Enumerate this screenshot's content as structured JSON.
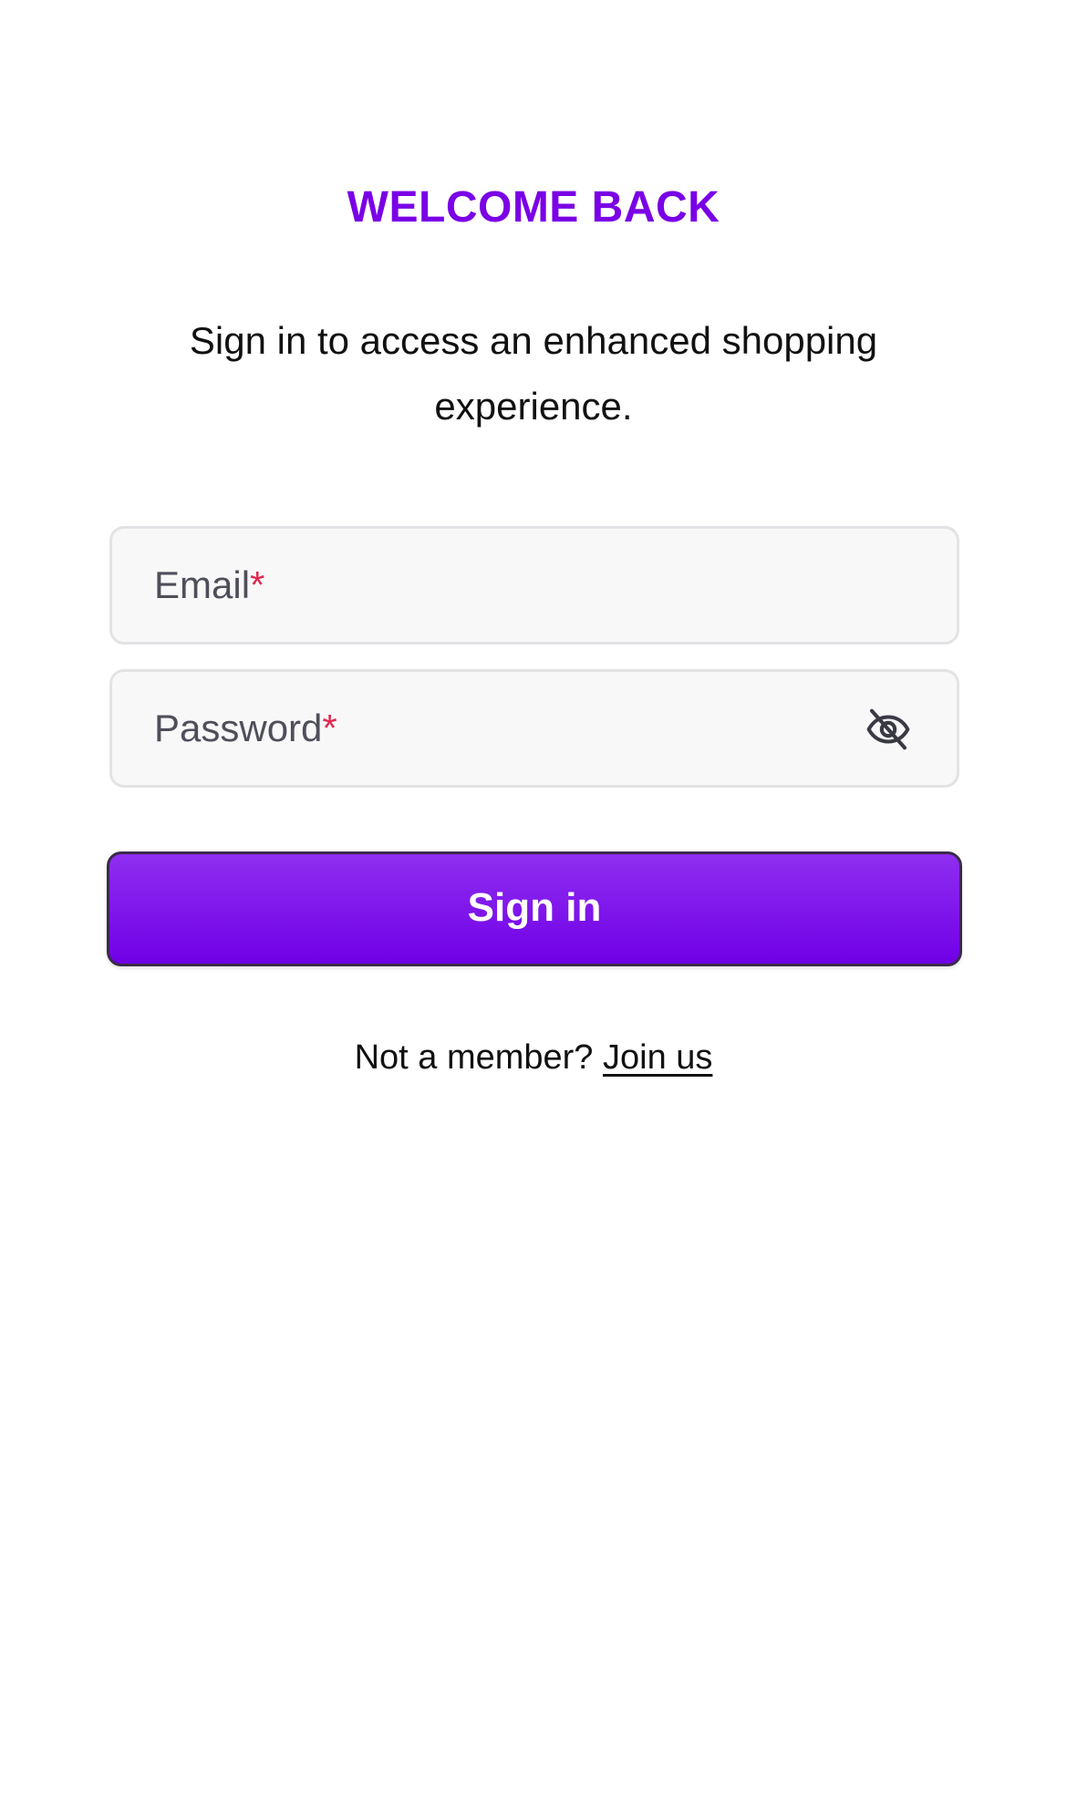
{
  "header": {
    "title": "WELCOME BACK",
    "subtitle": "Sign in to access an enhanced shopping experience."
  },
  "form": {
    "email": {
      "label": "Email",
      "required_marker": "*",
      "value": ""
    },
    "password": {
      "label": "Password",
      "required_marker": "*",
      "value": "",
      "toggle_icon": "eye-off-icon"
    },
    "submit_label": "Sign in"
  },
  "footer": {
    "prompt": "Not a member?",
    "link_label": "Join us"
  },
  "colors": {
    "accent": "#7A00E6",
    "required": "#E0284F",
    "field_bg": "#F8F8F9",
    "field_border": "#E3E3E6",
    "label_text": "#4F4F5A"
  }
}
